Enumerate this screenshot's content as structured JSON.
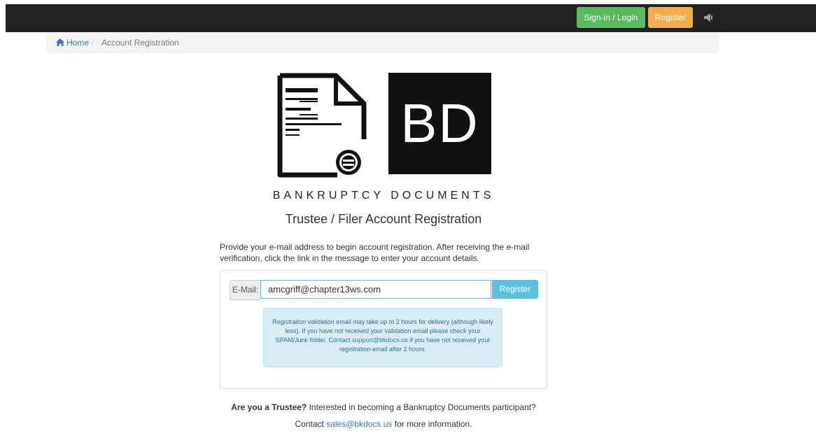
{
  "navbar": {
    "login_label": "Sign-in / Login",
    "register_label": "Register",
    "megaphone_icon": "megaphone-icon"
  },
  "breadcrumb": {
    "home_label": "Home",
    "home_icon": "home-icon",
    "separator": "/",
    "current": "Account Registration"
  },
  "logo": {
    "initials": "BD",
    "wordmark": "BANKRUPTCY DOCUMENTS"
  },
  "page": {
    "title": "Trustee / Filer Account Registration",
    "intro": "Provide your e-mail address to begin account registration. After receiving the e-mail verification, click the link in the message to enter your account details."
  },
  "form": {
    "email_label": "E-Mail:",
    "email_value": "amcgriff@chapter13ws.com",
    "register_button": "Register"
  },
  "notice": {
    "text_before_link": "Registraiton validation email may take up to 2 hours for delivery (although likely less). If you have not received your validation email please check your SPAM/Junk folder. Contact ",
    "support_email": "support@bkdocs.us",
    "text_after_link": " if you have not received your registration email after 2 hours."
  },
  "footer": {
    "trustee_question": "Are you a Trustee?",
    "trustee_text": " Interested in becoming a Bankruptcy Documents participant?",
    "contact_prefix": "Contact ",
    "sales_email": "sales@bkdocs.us",
    "contact_suffix": " for more information."
  },
  "colors": {
    "navbar_bg": "#222222",
    "login_btn": "#5cb85c",
    "register_btn": "#f0ad4e",
    "form_register_btn": "#5bc0de",
    "link": "#337ab7",
    "alert_bg": "#d9edf7"
  }
}
